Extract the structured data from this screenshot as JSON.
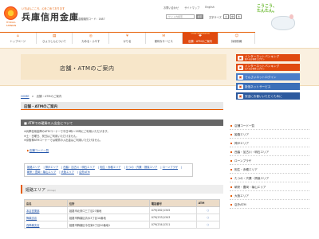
{
  "header": {
    "tagline": "いちばんこころ、心をこめております",
    "bank_name": "兵庫信用金庫",
    "logo_sub": "HYOGO-SHINKIN",
    "bank_code": "金融機関コード：1687",
    "util_links": [
      "お問い合わせ",
      "サイトマップ",
      "English"
    ],
    "search_placeholder": "サイト内検索",
    "search_button": "検索",
    "font_size_label": "文字サイズ",
    "font_sizes": [
      "小",
      "中",
      "大"
    ],
    "mascot_text": "こうこう、\nたんたん。"
  },
  "nav": {
    "items": [
      {
        "label": "トップページ",
        "icon": "home-icon",
        "glyph": "⌂",
        "active": false
      },
      {
        "label": "ひょうしんについて",
        "icon": "building-icon",
        "glyph": "▤",
        "active": false
      },
      {
        "label": "ためる・ふやす",
        "icon": "piggy-icon",
        "glyph": "◎",
        "active": false
      },
      {
        "label": "かりる",
        "icon": "coin-icon",
        "glyph": "¥",
        "active": false
      },
      {
        "label": "便利なサービス",
        "icon": "service-icon",
        "glyph": "✉",
        "active": false
      },
      {
        "label": "店舗・ATMのご案内",
        "icon": "map-icon",
        "glyph": "✚",
        "active": true,
        "sub": "STORE INFORMATION"
      },
      {
        "label": "採用情報",
        "icon": "recruit-icon",
        "glyph": "☺",
        "active": false
      }
    ]
  },
  "banner": {
    "title": "店舗・ATMのご案内"
  },
  "promos": [
    {
      "label": "インターネットバンキング",
      "sub": "個人のお客様 ログオン",
      "color": "#e04a10",
      "icon": "ib-icon"
    },
    {
      "label": "インターネットバンキング",
      "sub": "法人のお客様 ログオン",
      "color": "#e04a10",
      "icon": "ib-corp-icon"
    },
    {
      "label": "でんさいネットログイン",
      "sub": "",
      "color": "#4a7ec9",
      "icon": "densai-icon"
    },
    {
      "label": "投信ネットサービス",
      "sub": "",
      "color": "#3b6fb8",
      "icon": "fund-icon"
    },
    {
      "label": "安全にお使いいただくために",
      "sub": "",
      "color": "#2d5a9e",
      "icon": "shield-icon"
    }
  ],
  "breadcrumb": {
    "home": "HOME",
    "sep": ">",
    "current": "店舗・ATMのご案内"
  },
  "main": {
    "page_title": "店舗・ATMのご案内",
    "section_title": "ATMでの硬貨の入出金について",
    "notice_lines": [
      "※兵庫信用金庫のATMコーナーで平日9時～15時にご利用いただけます。",
      "※土・日曜日、祝日はご利用いただけません。",
      "※京阪神ATMコーナーでは硬貨の入出金はご利用いただけません。"
    ],
    "store_code_link": "店舗コード一覧",
    "area_links": [
      "姫路エリア",
      "神戸エリア",
      "西脇・加古川・明石エリア",
      "相生・赤穂エリア",
      "たつの・宍粟・揖保エリア",
      "ローンプラザ",
      "朝来・豊岡・篠山エリア",
      "大阪エリア",
      "店外ATM"
    ],
    "area_head": "姫路エリア",
    "area_sub": "(Himeji)",
    "table": {
      "headers": [
        "店名",
        "住所",
        "電話番号",
        "ATM"
      ],
      "rows": [
        [
          "本店営業部",
          "姫路市北条口三丁目27番地",
          "079(282)1345",
          "○"
        ],
        [
          "飾磨支店",
          "姫路市飾磨区清水3丁目10番地",
          "079(233)1343",
          "○"
        ],
        [
          "西飾磨支店",
          "姫路市飾磨区今在家4丁目20番地1",
          "079(234)1311",
          "○"
        ]
      ]
    }
  },
  "sidebar": {
    "items": [
      "店舗コード一覧",
      "姫路エリア",
      "神戸エリア",
      "西脇・加古川・明石エリア",
      "ローンプラザ",
      "相生・赤穂エリア",
      "たつの・宍粟・揖保エリア",
      "朝来・豊岡・篠山エリア",
      "大阪エリア",
      "店外ATM"
    ]
  }
}
